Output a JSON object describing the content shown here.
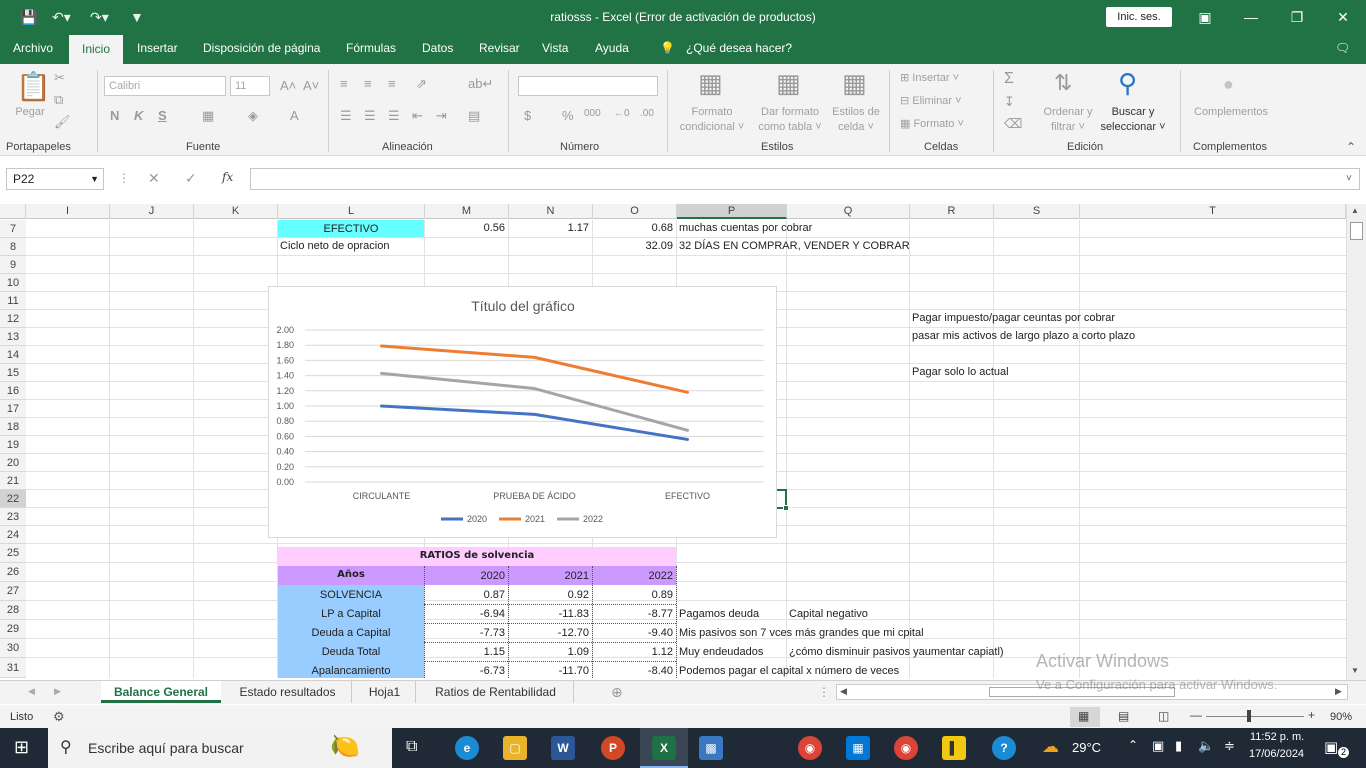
{
  "window": {
    "title": "ratiosss  -  Excel (Error de activación de productos)",
    "signin": "Inic. ses."
  },
  "menu": [
    "Archivo",
    "Inicio",
    "Insertar",
    "Disposición de página",
    "Fórmulas",
    "Datos",
    "Revisar",
    "Vista",
    "Ayuda",
    "¿Qué desea hacer?"
  ],
  "ribbon": {
    "groups": [
      "Portapapeles",
      "Fuente",
      "Alineación",
      "Número",
      "Estilos",
      "Celdas",
      "Edición",
      "Complementos"
    ],
    "paste": "Pegar",
    "font_name": "Calibri",
    "font_size": "11",
    "bold": "N",
    "italic": "K",
    "underline": "S",
    "conditional_format": [
      "Formato",
      "condicional"
    ],
    "format_table": [
      "Dar formato",
      "como tabla"
    ],
    "cell_styles": [
      "Estilos de",
      "celda"
    ],
    "insert": "Insertar",
    "delete": "Eliminar",
    "format": "Formato",
    "sort_filter": [
      "Ordenar y",
      "filtrar"
    ],
    "find_select": [
      "Buscar y",
      "seleccionar"
    ],
    "addins": "Complementos"
  },
  "formula_bar": {
    "cell_ref": "P22",
    "fx": "fx",
    "value": ""
  },
  "columns": [
    {
      "name": "I"
    },
    {
      "name": "J"
    },
    {
      "name": "K"
    },
    {
      "name": "L"
    },
    {
      "name": "M"
    },
    {
      "name": "N"
    },
    {
      "name": "O"
    },
    {
      "name": "P"
    },
    {
      "name": "Q"
    },
    {
      "name": "R"
    },
    {
      "name": "S"
    },
    {
      "name": "T"
    }
  ],
  "rows": [
    "7",
    "8",
    "9",
    "10",
    "11",
    "12",
    "13",
    "14",
    "15",
    "16",
    "17",
    "18",
    "19",
    "20",
    "21",
    "22",
    "23",
    "24",
    "25",
    "26",
    "27",
    "28",
    "29",
    "30",
    "31"
  ],
  "cells": {
    "r7": {
      "L": "EFECTIVO",
      "M": "0.56",
      "N": "1.17",
      "O": "0.68",
      "P": "muchas cuentas por cobrar"
    },
    "r8": {
      "L": "Ciclo neto de opracion",
      "O": "32.09",
      "P": "32 DÍAS EN COMPRAR, VENDER Y COBRAR"
    },
    "r12": {
      "R": "Pagar impuesto/pagar ceuntas por cobrar"
    },
    "r13": {
      "R": "pasar mis activos de largo plazo a corto plazo"
    },
    "r15": {
      "R": "Pagar solo lo actual"
    },
    "r25": {
      "L": "RATIOS de solvencia"
    },
    "r26": {
      "L": "Años",
      "M": "2020",
      "N": "2021",
      "O": "2022"
    },
    "r27": {
      "L": "SOLVENCIA",
      "M": "0.87",
      "N": "0.92",
      "O": "0.89"
    },
    "r28": {
      "L": "LP a Capital",
      "M": "-6.94",
      "N": "-11.83",
      "O": "-8.77",
      "P": "Pagamos deuda",
      "Q": "Capital negativo"
    },
    "r29": {
      "L": "Deuda a Capital",
      "M": "-7.73",
      "N": "-12.70",
      "O": "-9.40",
      "P": "Mis pasivos son 7 vces más grandes que mi cpital"
    },
    "r30": {
      "L": "Deuda Total",
      "M": "1.15",
      "N": "1.09",
      "O": "1.12",
      "P": "Muy endeudados",
      "Q": "¿cómo disminuir pasivos yaumentar capiatl)"
    },
    "r31": {
      "L": "Apalancamiento",
      "M": "-6.73",
      "N": "-11.70",
      "O": "-8.40",
      "P": "Podemos pagar el capital x número de veces"
    }
  },
  "chart_data": {
    "type": "line",
    "title": "Título del gráfico",
    "categories": [
      "CIRCULANTE",
      "PRUEBA DE ÁCIDO",
      "EFECTIVO"
    ],
    "series": [
      {
        "name": "2020",
        "color": "#4472c4",
        "values": [
          1.0,
          0.89,
          0.56
        ]
      },
      {
        "name": "2021",
        "color": "#ed7d31",
        "values": [
          1.79,
          1.64,
          1.18
        ]
      },
      {
        "name": "2022",
        "color": "#a5a5a5",
        "values": [
          1.43,
          1.23,
          0.68
        ]
      }
    ],
    "yticks": [
      "0.00",
      "0.20",
      "0.40",
      "0.60",
      "0.80",
      "1.00",
      "1.20",
      "1.40",
      "1.60",
      "1.80",
      "2.00"
    ],
    "ylim": [
      0,
      2
    ],
    "legend": "bottom",
    "grid": true
  },
  "sheets": [
    "Balance General",
    "Estado resultados",
    "Hoja1",
    "Ratios de Rentabilidad"
  ],
  "active_sheet": "Balance General",
  "status": {
    "ready": "Listo",
    "zoom": "90%"
  },
  "watermark": {
    "line1": "Activar Windows",
    "line2": "Ve a Configuración para activar Windows."
  },
  "taskbar": {
    "search": "Escribe aquí para buscar",
    "temp": "29°C",
    "time": "11:52 p. m.",
    "date": "17/06/2024",
    "notifications": "2"
  },
  "colors": {
    "excel_green": "#217346",
    "cyan_cell": "#66ffff",
    "pink_header": "#ffccff",
    "purple_header": "#cc99ff",
    "blue_label": "#99ccff"
  }
}
